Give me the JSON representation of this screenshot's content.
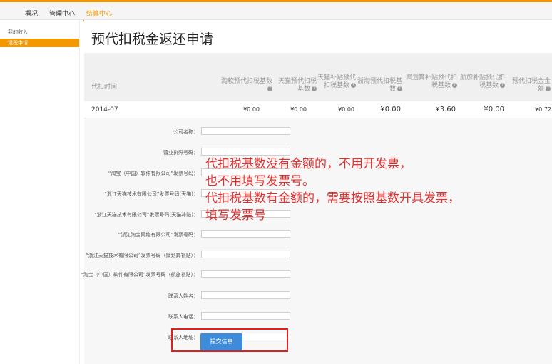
{
  "topnav": {
    "overview": "概况",
    "management": "管理中心",
    "settlement": "结算中心"
  },
  "sidebar": {
    "income": "我的收入",
    "tax_refund": "退税申请"
  },
  "page": {
    "title": "预代扣税金返还申请"
  },
  "table": {
    "headers": [
      "代扣时间",
      "淘软预代扣税基数",
      "天猫预代扣税基数",
      "天猫补贴预代扣税基数",
      "浙淘预代扣税基数",
      "聚划算补贴预代扣税基数",
      "航旅补贴预代扣税基数",
      "预代扣税金金额"
    ],
    "rows": [
      [
        "2014-07",
        "¥0.00",
        "¥0.00",
        "¥0.00",
        "¥0.00",
        "¥3.60",
        "¥0.00",
        "¥0.72"
      ]
    ]
  },
  "form": {
    "fields": [
      "公司名称：",
      "营业执照号码：",
      "“淘宝（中国）软件有限公司”发票号码：",
      "“浙江天猫技术有限公司”发票号码(天猫)：",
      "“浙江天猫技术有限公司”发票号码(天猫补贴)：",
      "“浙江淘宝网络有限公司”发票号码：",
      "“浙江天猫技术有限公司”发票号码（聚划算补贴）：",
      "“淘宝（中国）软件有限公司”发票号码（航旅补贴）：",
      "联系人姓名：",
      "联系人电话：",
      "联系人地址："
    ],
    "submit_label": "提交信息"
  },
  "annotation": {
    "lines": [
      "代扣税基数没有金额的，不用开发票，",
      "也不用填写发票号。",
      "代扣税基数有金额的，需要按照基数开具发票，",
      "填写发票号"
    ]
  },
  "colors": {
    "accent": "#f39800",
    "button": "#3d8bd9",
    "annotation": "#e03030"
  }
}
